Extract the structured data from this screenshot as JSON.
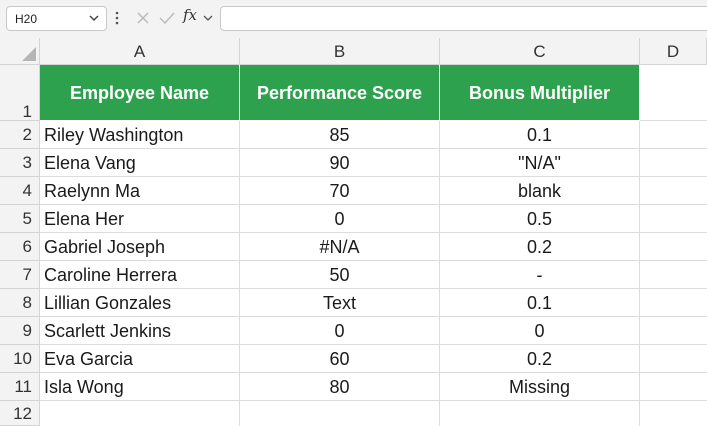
{
  "formula_bar": {
    "name_box": "H20",
    "fx_label": "fx",
    "formula": ""
  },
  "columns": [
    "A",
    "B",
    "C",
    "D"
  ],
  "rows": [
    "1",
    "2",
    "3",
    "4",
    "5",
    "6",
    "7",
    "8",
    "9",
    "10",
    "11",
    "12"
  ],
  "header": [
    "Employee Name",
    "Performance Score",
    "Bonus Multiplier"
  ],
  "data": [
    [
      "Riley Washington",
      "85",
      "0.1"
    ],
    [
      "Elena Vang",
      "90",
      "\"N/A\""
    ],
    [
      "Raelynn Ma",
      "70",
      "blank"
    ],
    [
      "Elena Her",
      "0",
      "0.5"
    ],
    [
      "Gabriel Joseph",
      "#N/A",
      "0.2"
    ],
    [
      "Caroline Herrera",
      "50",
      "-"
    ],
    [
      "Lillian Gonzales",
      "Text",
      "0.1"
    ],
    [
      "Scarlett Jenkins",
      "0",
      "0"
    ],
    [
      "Eva Garcia",
      "60",
      "0.2"
    ],
    [
      "Isla Wong",
      "80",
      "Missing"
    ]
  ],
  "colors": {
    "header_fill": "#2ea14e",
    "header_text": "#ffffff",
    "gridline": "#dcdcdc",
    "heading_bg": "#f3f3f3"
  },
  "icons": [
    "chevron-down-icon",
    "more-options-icon",
    "cancel-icon",
    "check-icon",
    "function-icon"
  ]
}
